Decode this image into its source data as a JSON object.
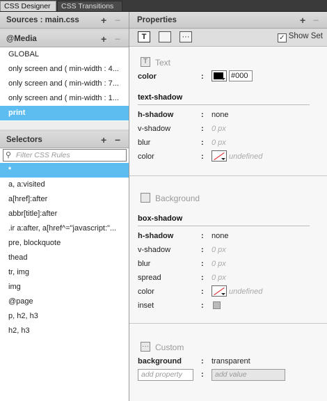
{
  "tabs": [
    "CSS Designer",
    "CSS Transitions"
  ],
  "sources": {
    "title": "Sources : main.css",
    "add": "+",
    "remove": "−"
  },
  "media": {
    "title": "@Media",
    "add": "+",
    "remove": "−",
    "items": [
      "GLOBAL",
      "only screen and ( min-width : 4...",
      "only screen and ( min-width : 7...",
      "only screen and ( min-width : 1...",
      "print"
    ],
    "selected_index": 4
  },
  "selectors": {
    "title": "Selectors",
    "add": "+",
    "remove": "−",
    "filter_placeholder": "Filter CSS Rules",
    "items": [
      "*",
      "a, a:visited",
      "a[href]:after",
      "abbr[title]:after",
      ".ir a:after, a[href^=\"javascript:\"...",
      "pre, blockquote",
      "thead",
      "tr, img",
      "img",
      "@page",
      "p, h2, h3",
      "h2, h3"
    ],
    "selected_index": 0
  },
  "properties": {
    "title": "Properties",
    "add": "+",
    "remove": "−",
    "show_set_label": "Show Set",
    "show_set_checked": true,
    "text_group": {
      "title": "Text",
      "color_label": "color",
      "color_value": "#000",
      "text_shadow_title": "text-shadow",
      "h_shadow_label": "h-shadow",
      "h_shadow_value": "none",
      "v_shadow_label": "v-shadow",
      "v_shadow_value": "0 px",
      "blur_label": "blur",
      "blur_value": "0 px",
      "color2_label": "color",
      "color2_value": "undefined"
    },
    "background_group": {
      "title": "Background",
      "box_shadow_title": "box-shadow",
      "h_shadow_label": "h-shadow",
      "h_shadow_value": "none",
      "v_shadow_label": "v-shadow",
      "v_shadow_value": "0 px",
      "blur_label": "blur",
      "blur_value": "0 px",
      "spread_label": "spread",
      "spread_value": "0 px",
      "color_label": "color",
      "color_value": "undefined",
      "inset_label": "inset"
    },
    "custom_group": {
      "title": "Custom",
      "background_label": "background",
      "background_value": "transparent",
      "add_property_placeholder": "add property",
      "add_value_placeholder": "add value"
    },
    "colon": ":"
  },
  "colors": {
    "selection": "#5ebdf0",
    "tab_bar": "#3a3a3a",
    "undefined_swatch": "#e02020"
  }
}
